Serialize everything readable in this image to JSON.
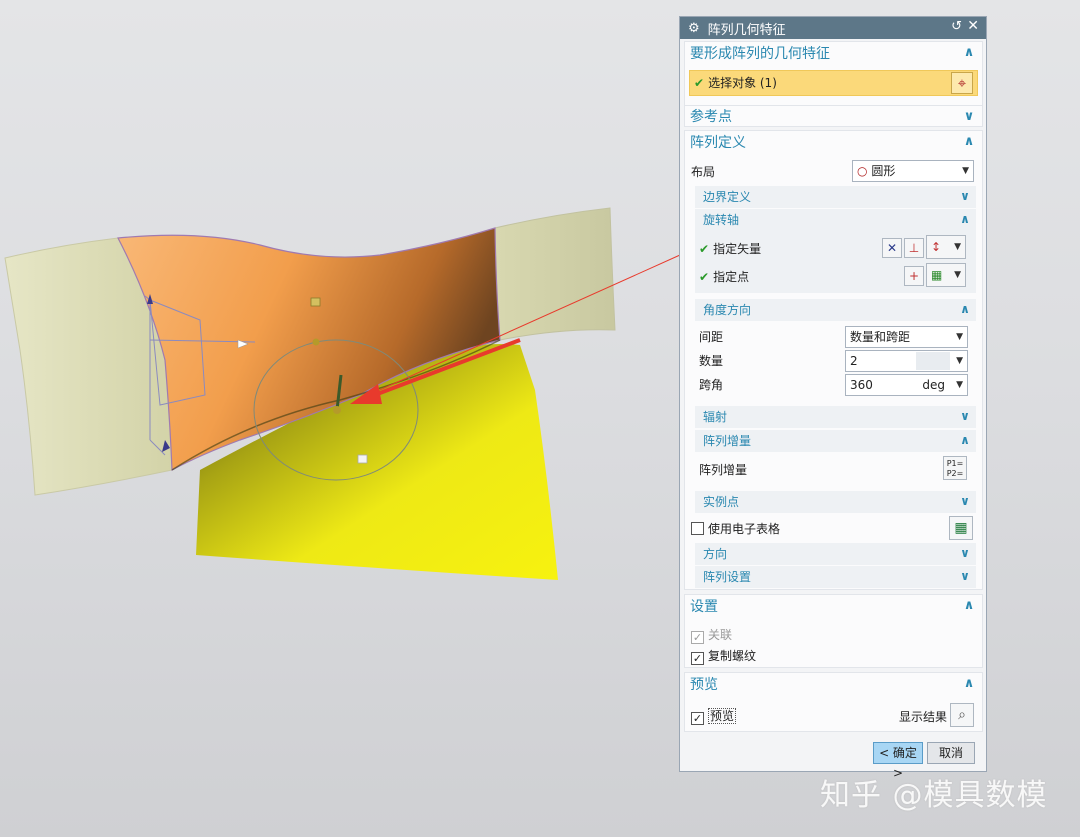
{
  "dialog": {
    "title": "阵列几何特征",
    "reset_glyph": "↺",
    "close_glyph": "✕",
    "sections": {
      "geometry": {
        "title": "要形成阵列的几何特征",
        "select_label": "选择对象 (1)"
      },
      "ref_point": {
        "title": "参考点"
      },
      "array_def": {
        "title": "阵列定义",
        "layout_label": "布局",
        "layout_value": "圆形",
        "boundary": "边界定义",
        "rotation_axis": {
          "title": "旋转轴",
          "specify_vector": "指定矢量",
          "specify_point": "指定点"
        },
        "angle_direction": {
          "title": "角度方向",
          "spacing_label": "间距",
          "spacing_value": "数量和跨距",
          "count_label": "数量",
          "count_value": "2",
          "span_label": "跨角",
          "span_value": "360",
          "span_unit": "deg"
        },
        "radiation": "辐射",
        "increment": {
          "title": "阵列增量",
          "label": "阵列增量"
        },
        "instance_point": "实例点",
        "use_spreadsheet": "使用电子表格",
        "orientation": "方向",
        "array_settings": "阵列设置"
      },
      "settings": {
        "title": "设置",
        "associative": "关联",
        "copy_threads": "复制螺纹"
      },
      "preview": {
        "title": "预览",
        "preview_label": "预览",
        "show_result": "显示结果"
      }
    },
    "ok_label": "< 确定 >",
    "cancel_label": "取消"
  },
  "watermark": "知乎 @模具数模",
  "colors": {
    "title_bar": "#5d7788",
    "section_title": "#2a88b0",
    "selected_row": "#fbd97a",
    "surface_orange": "#f0a050",
    "surface_yellow": "#f2ec12",
    "surface_pale": "#dcdcb2",
    "arrow_red": "#e83a2c"
  }
}
